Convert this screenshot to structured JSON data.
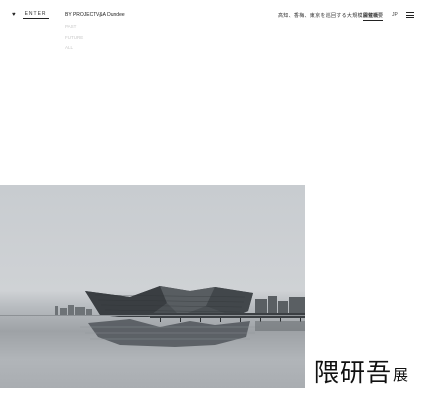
{
  "header": {
    "enter_label": "ENTER",
    "project_select": "BY PROJECT",
    "project_title": "V&A Dundee",
    "tagline": "高知、香梅、東京を巡回する大規模展覧会",
    "overview_link": "開催概要",
    "language": "JP"
  },
  "dropdown": {
    "options": [
      "PAST",
      "FUTURE",
      "ALL"
    ]
  },
  "logo": {
    "main": "隈研吾",
    "suffix": "展"
  },
  "icons": {
    "heart": "heart-icon",
    "menu": "hamburger-menu-icon",
    "chevron": "chevron-down-icon"
  }
}
